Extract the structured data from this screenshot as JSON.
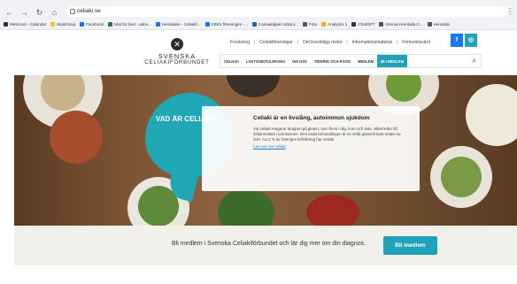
{
  "browser": {
    "url": "celiaki.se",
    "nav_icons": [
      "back-arrow-icon",
      "forward-arrow-icon",
      "reload-icon",
      "home-icon"
    ],
    "bookmarks": [
      {
        "label": "Metricool - Calendar",
        "icon_color": "#333333"
      },
      {
        "label": "Mailchimp",
        "icon_color": "#f5c518"
      },
      {
        "label": "Facebook",
        "icon_color": "#1877f2"
      },
      {
        "label": "Mat för livet - admi...",
        "icon_color": "#2f6f4e"
      },
      {
        "label": "Hemsidan - Celiakif...",
        "icon_color": "#1a73e8"
      },
      {
        "label": "Sthlm föreningen -...",
        "icon_color": "#1a73e8"
      },
      {
        "label": "Canvas/pper Admini...",
        "icon_color": "#1565c0"
      },
      {
        "label": "Foto",
        "icon_color": "#555555"
      },
      {
        "label": "Analytics 1",
        "icon_color": "#f9a825"
      },
      {
        "label": "ChatGPT",
        "icon_color": "#333333"
      },
      {
        "label": "Interna Hemsida C...",
        "icon_color": "#555555"
      },
      {
        "label": "Hemsida",
        "icon_color": "#555555"
      }
    ]
  },
  "header": {
    "logo_line1": "SVENSKA",
    "logo_line2": "CELIAKIFÖRBUNDET",
    "top_links": [
      "Forskning",
      "Celiakiföreningar",
      "Det livsviktiga melet",
      "Informationsmaterial",
      "Fortsvärlsvärd"
    ],
    "social": [
      {
        "name": "facebook-icon",
        "glyph": "f",
        "color": "#1877f2"
      },
      {
        "name": "instagram-icon",
        "glyph": "◎",
        "color": "#1fa3b8"
      }
    ],
    "nav": [
      {
        "label": "CELIAKI",
        "active": false
      },
      {
        "label": "LAKTOSINTOLERANS",
        "active": false
      },
      {
        "label": "OM OSS",
        "active": false
      },
      {
        "label": "TIDNING OCH POOD",
        "active": false
      },
      {
        "label": "MEDLEM",
        "active": false
      },
      {
        "label": "BLI MEDLEM",
        "active": true
      }
    ],
    "search_icon": "search-icon"
  },
  "hero": {
    "teal_title": "VAD ÄR CELIAKI?",
    "card_heading": "Celiaki är en livslång, autoimmun sjukdom",
    "card_text": "Vid celiaki reagerar kroppen på gluten, som finns i råg, korn och vete, vilket leder till inflammation i tunntarmen. Den enda behandlingen är en strikt glutenfri kost resten av livet. Ca 2 % av Sveriges befolkning har celiaki.",
    "card_link": "Läs mer om celiaki",
    "colors": {
      "teal": "#20a8b6"
    }
  },
  "cta": {
    "text": "Bli medlem i Svenska Celiakiförbundet och lär dig mer om din diagnos.",
    "button_label": "Bli medlem",
    "button_color": "#1fa3b8"
  }
}
